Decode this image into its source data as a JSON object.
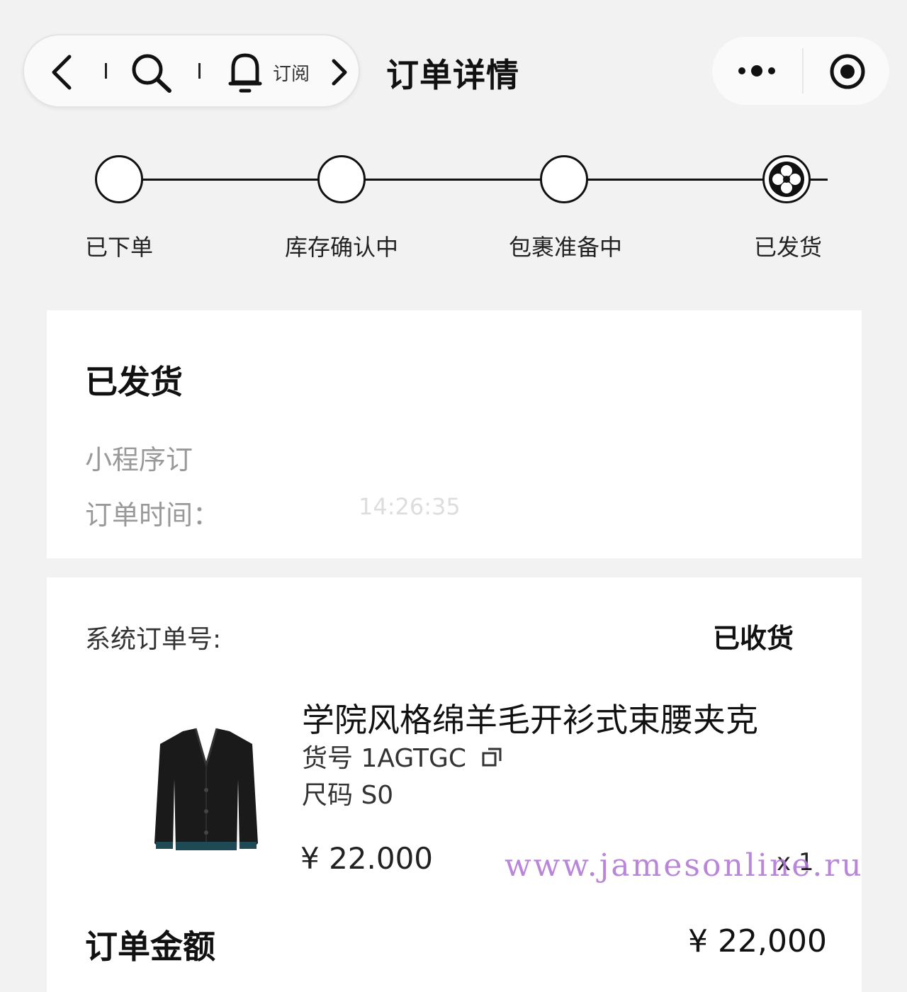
{
  "nav": {
    "subscribe_label": "订阅",
    "page_title": "订单详情"
  },
  "progress": {
    "steps": [
      {
        "label": "已下单"
      },
      {
        "label": "库存确认中"
      },
      {
        "label": "包裹准备中"
      },
      {
        "label": "已发货"
      }
    ],
    "current_step": 4
  },
  "status_card": {
    "title": "已发货",
    "mini_order_label": "小程序订",
    "order_time_label": "订单时间：",
    "order_time_value": "14:26:35"
  },
  "order_card": {
    "system_order_label": "系统订单号:",
    "status": "已收货",
    "product": {
      "name": "学院风格绵羊毛开衫式束腰夹克",
      "sku": "货号 1AGTGC",
      "size": "尺码 S0",
      "price": "¥ 22.000",
      "quantity": "x 1"
    },
    "total_label": "订单金额",
    "total_value": "¥ 22,000"
  },
  "watermark": "www.jamesonline.ru",
  "colors": {
    "background": "#f2f2f2",
    "card": "#ffffff",
    "text": "#111111",
    "watermark": "#b27ad6"
  }
}
